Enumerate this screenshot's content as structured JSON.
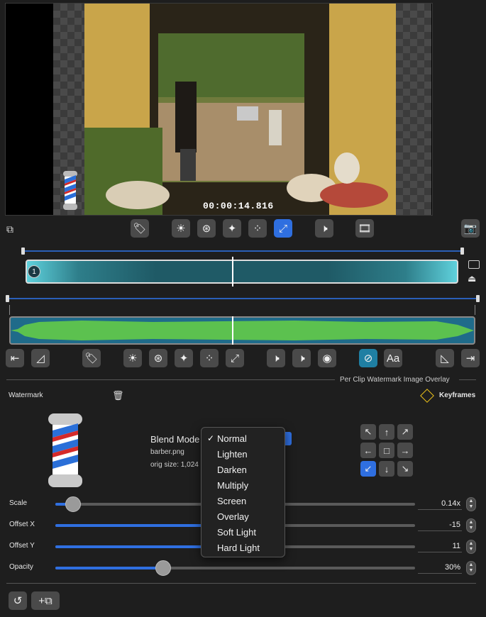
{
  "video": {
    "timecode": "00:00:14.816"
  },
  "panel": {
    "section_title": "Per Clip Watermark Image Overlay",
    "watermark_label": "Watermark",
    "keyframes_label": "Keyframes",
    "blend_mode_label": "Blend Mode",
    "filename": "barber.png",
    "orig_size": "orig size: 1,024"
  },
  "clip": {
    "number": "1"
  },
  "sliders": [
    {
      "label": "Scale",
      "value": "0.14x",
      "fraction": 0.05
    },
    {
      "label": "Offset X",
      "value": "-15",
      "fraction": 0.42
    },
    {
      "label": "Offset Y",
      "value": "11",
      "fraction": 0.42
    },
    {
      "label": "Opacity",
      "value": "30%",
      "fraction": 0.3
    }
  ],
  "blend_menu": {
    "selected": "Normal",
    "items": [
      "Normal",
      "Lighten",
      "Darken",
      "Multiply",
      "Screen",
      "Overlay",
      "Soft Light",
      "Hard Light"
    ]
  },
  "position_grid": {
    "arrows": [
      "↖",
      "↑",
      "↗",
      "←",
      "□",
      "→",
      "↙",
      "↓",
      "↘"
    ],
    "selected_index": 6
  },
  "colors": {
    "accent": "#2f6fe0",
    "waveform": "#5cc14f",
    "clip": "#3aa5b3",
    "keyframe": "#f0c419"
  },
  "toolbar_text": {
    "text_tool": "Aa"
  }
}
